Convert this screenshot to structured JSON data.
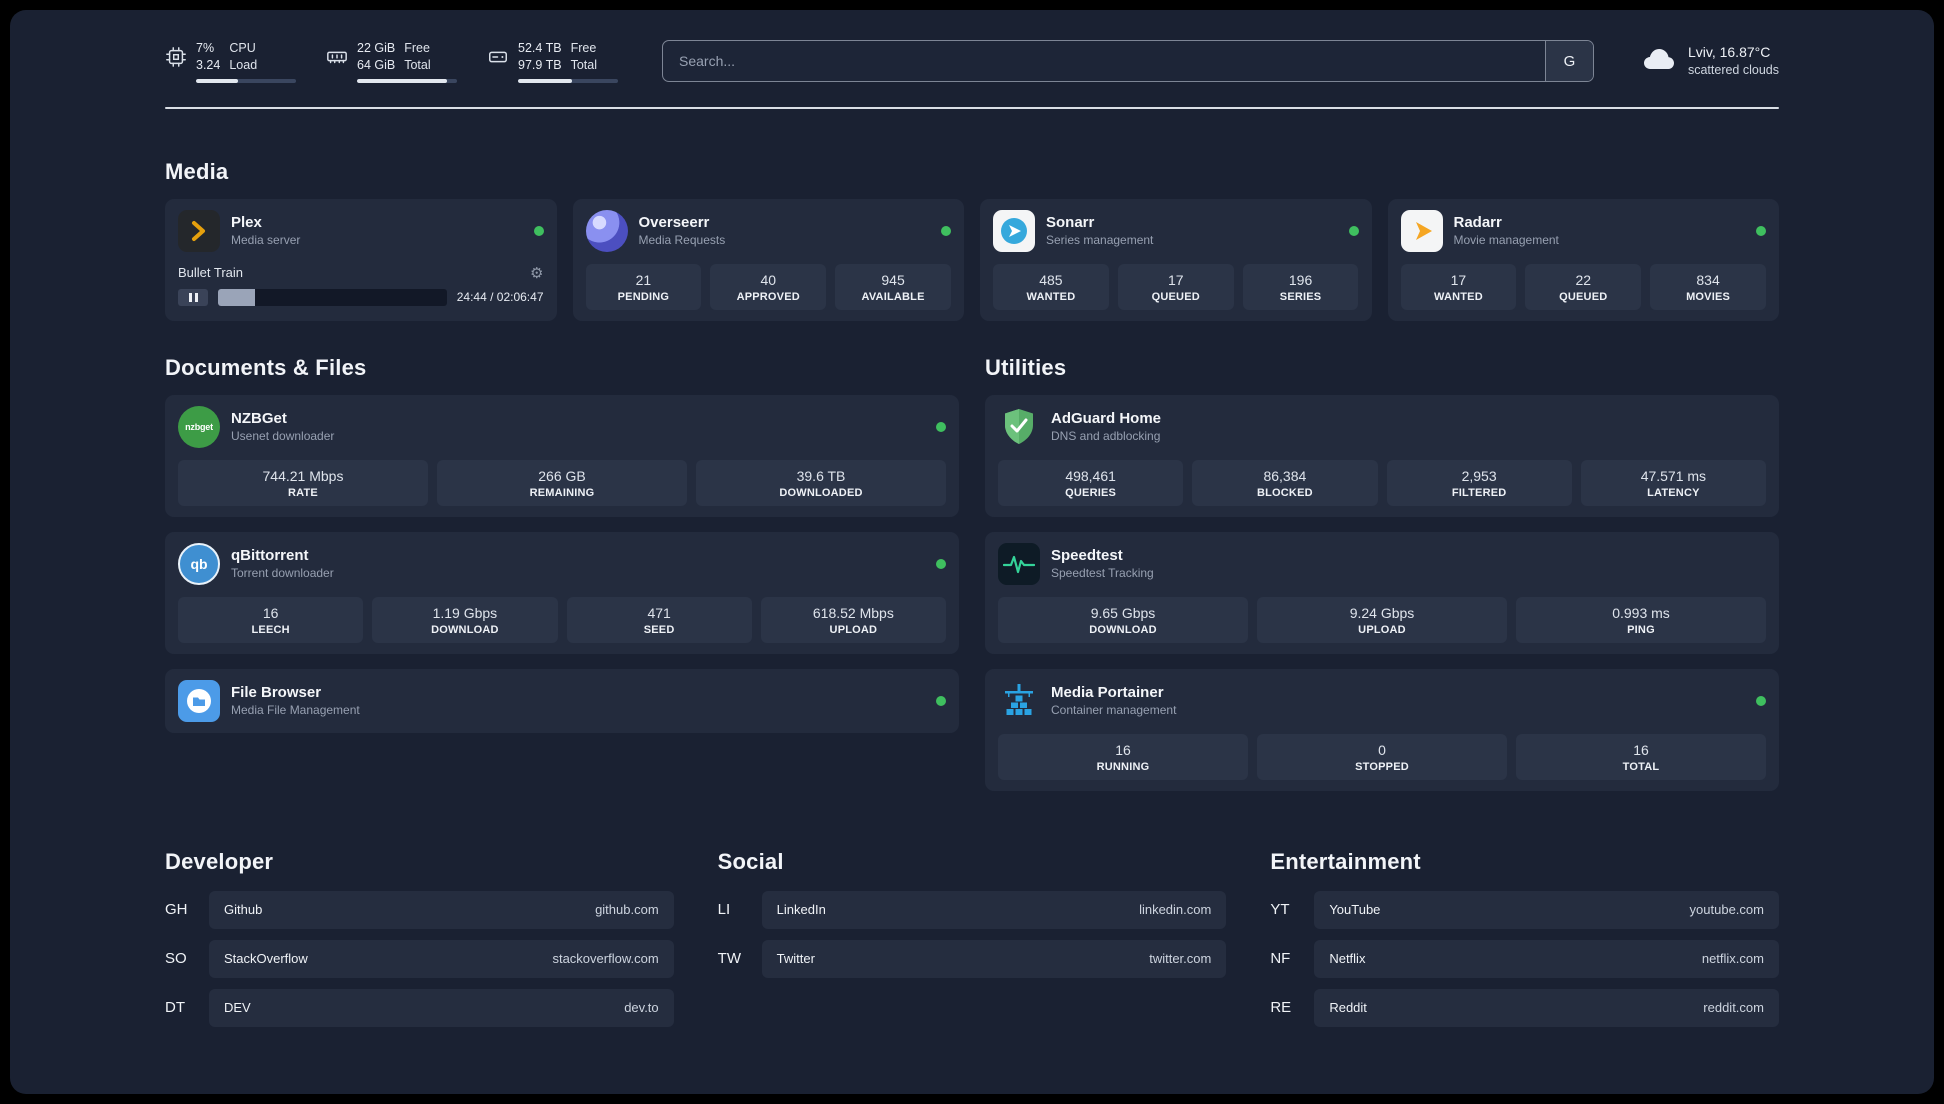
{
  "header": {
    "cpu": {
      "percent": "7%",
      "load": "3.24",
      "l1": "CPU",
      "l2": "Load",
      "progress": 42
    },
    "ram": {
      "v1": "22 GiB",
      "v2": "64 GiB",
      "l1": "Free",
      "l2": "Total",
      "progress": 90
    },
    "disk": {
      "v1": "52.4 TB",
      "v2": "97.9 TB",
      "l1": "Free",
      "l2": "Total",
      "progress": 54
    },
    "search": {
      "placeholder": "Search...",
      "engine": "G"
    },
    "weather": {
      "location": "Lviv, 16.87°C",
      "condition": "scattered clouds"
    }
  },
  "sections": {
    "media": {
      "title": "Media"
    },
    "documents": {
      "title": "Documents & Files"
    },
    "utilities": {
      "title": "Utilities"
    },
    "developer": {
      "title": "Developer"
    },
    "social": {
      "title": "Social"
    },
    "entertainment": {
      "title": "Entertainment"
    }
  },
  "apps": {
    "plex": {
      "name": "Plex",
      "subtitle": "Media server",
      "player": {
        "title": "Bullet Train",
        "time": "24:44 / 02:06:47",
        "progress": 16
      }
    },
    "overseerr": {
      "name": "Overseerr",
      "subtitle": "Media Requests",
      "stats": [
        {
          "value": "21",
          "label": "PENDING"
        },
        {
          "value": "40",
          "label": "APPROVED"
        },
        {
          "value": "945",
          "label": "AVAILABLE"
        }
      ]
    },
    "sonarr": {
      "name": "Sonarr",
      "subtitle": "Series management",
      "stats": [
        {
          "value": "485",
          "label": "WANTED"
        },
        {
          "value": "17",
          "label": "QUEUED"
        },
        {
          "value": "196",
          "label": "SERIES"
        }
      ]
    },
    "radarr": {
      "name": "Radarr",
      "subtitle": "Movie management",
      "stats": [
        {
          "value": "17",
          "label": "WANTED"
        },
        {
          "value": "22",
          "label": "QUEUED"
        },
        {
          "value": "834",
          "label": "MOVIES"
        }
      ]
    },
    "nzbget": {
      "name": "NZBGet",
      "subtitle": "Usenet downloader",
      "icon_text": "nzbget",
      "stats": [
        {
          "value": "744.21 Mbps",
          "label": "RATE"
        },
        {
          "value": "266 GB",
          "label": "REMAINING"
        },
        {
          "value": "39.6 TB",
          "label": "DOWNLOADED"
        }
      ]
    },
    "qbittorrent": {
      "name": "qBittorrent",
      "subtitle": "Torrent downloader",
      "icon_text": "qb",
      "stats": [
        {
          "value": "16",
          "label": "LEECH"
        },
        {
          "value": "1.19 Gbps",
          "label": "DOWNLOAD"
        },
        {
          "value": "471",
          "label": "SEED"
        },
        {
          "value": "618.52 Mbps",
          "label": "UPLOAD"
        }
      ]
    },
    "filebrowser": {
      "name": "File Browser",
      "subtitle": "Media File Management"
    },
    "adguard": {
      "name": "AdGuard Home",
      "subtitle": "DNS and adblocking",
      "stats": [
        {
          "value": "498,461",
          "label": "QUERIES"
        },
        {
          "value": "86,384",
          "label": "BLOCKED"
        },
        {
          "value": "2,953",
          "label": "FILTERED"
        },
        {
          "value": "47.571 ms",
          "label": "LATENCY"
        }
      ]
    },
    "speedtest": {
      "name": "Speedtest",
      "subtitle": "Speedtest Tracking",
      "stats": [
        {
          "value": "9.65 Gbps",
          "label": "DOWNLOAD"
        },
        {
          "value": "9.24 Gbps",
          "label": "UPLOAD"
        },
        {
          "value": "0.993 ms",
          "label": "PING"
        }
      ]
    },
    "portainer": {
      "name": "Media Portainer",
      "subtitle": "Container management",
      "stats": [
        {
          "value": "16",
          "label": "RUNNING"
        },
        {
          "value": "0",
          "label": "STOPPED"
        },
        {
          "value": "16",
          "label": "TOTAL"
        }
      ]
    }
  },
  "links": {
    "developer": [
      {
        "abbr": "GH",
        "name": "Github",
        "url": "github.com"
      },
      {
        "abbr": "SO",
        "name": "StackOverflow",
        "url": "stackoverflow.com"
      },
      {
        "abbr": "DT",
        "name": "DEV",
        "url": "dev.to"
      }
    ],
    "social": [
      {
        "abbr": "LI",
        "name": "LinkedIn",
        "url": "linkedin.com"
      },
      {
        "abbr": "TW",
        "name": "Twitter",
        "url": "twitter.com"
      }
    ],
    "entertainment": [
      {
        "abbr": "YT",
        "name": "YouTube",
        "url": "youtube.com"
      },
      {
        "abbr": "NF",
        "name": "Netflix",
        "url": "netflix.com"
      },
      {
        "abbr": "RE",
        "name": "Reddit",
        "url": "reddit.com"
      }
    ]
  },
  "colors": {
    "status_online": "#3fbf5f",
    "accent_amber": "#e5a00d"
  }
}
